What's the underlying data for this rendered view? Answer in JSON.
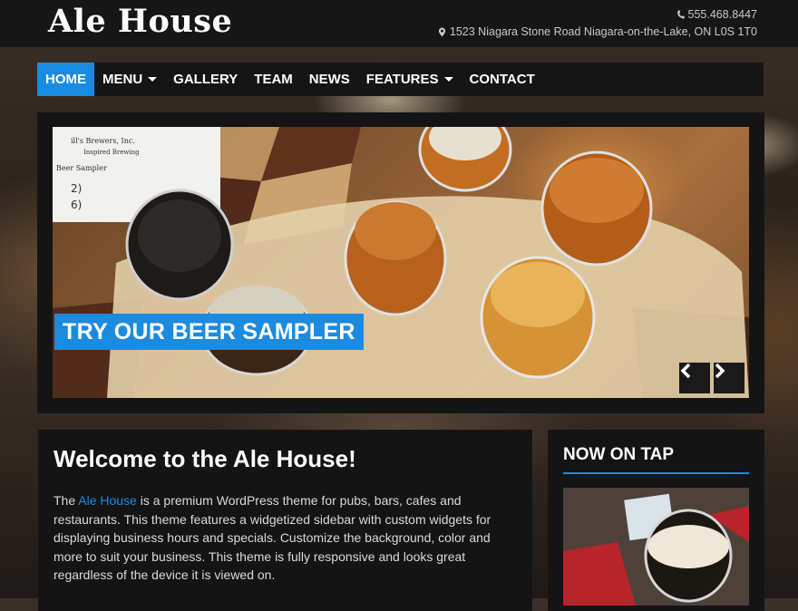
{
  "site": {
    "title": "Ale House",
    "phone": "555.468.8447",
    "address": "1523 Niagara Stone Road Niagara-on-the-Lake, ON L0S 1T0"
  },
  "nav": {
    "items": [
      {
        "label": "HOME",
        "active": true,
        "dropdown": false
      },
      {
        "label": "MENU",
        "active": false,
        "dropdown": true
      },
      {
        "label": "GALLERY",
        "active": false,
        "dropdown": false
      },
      {
        "label": "TEAM",
        "active": false,
        "dropdown": false
      },
      {
        "label": "NEWS",
        "active": false,
        "dropdown": false
      },
      {
        "label": "FEATURES",
        "active": false,
        "dropdown": true
      },
      {
        "label": "CONTACT",
        "active": false,
        "dropdown": false
      }
    ]
  },
  "slider": {
    "caption": "TRY OUR BEER SAMPLER",
    "prev_icon": "chevron-left-icon",
    "next_icon": "chevron-right-icon",
    "menu_card_lines": [
      "ill's Brewers, Inc.",
      "Inspired Brewing",
      "Beer Sampler",
      "2)",
      "6)"
    ]
  },
  "welcome": {
    "title": "Welcome to the Ale House!",
    "text_before": "The ",
    "link_text": "Ale House",
    "text_after": " is a premium WordPress theme for pubs, bars, cafes and restaurants.  This theme features a widgetized sidebar with custom widgets for displaying business hours and specials.  Customize the background, color and more to suit your business.  This theme is fully responsive and looks great regardless of the device it is viewed on."
  },
  "sidebar": {
    "widget_title": "NOW ON TAP"
  },
  "colors": {
    "accent": "#1b8be0",
    "panel": "#141414",
    "header": "#161616"
  }
}
